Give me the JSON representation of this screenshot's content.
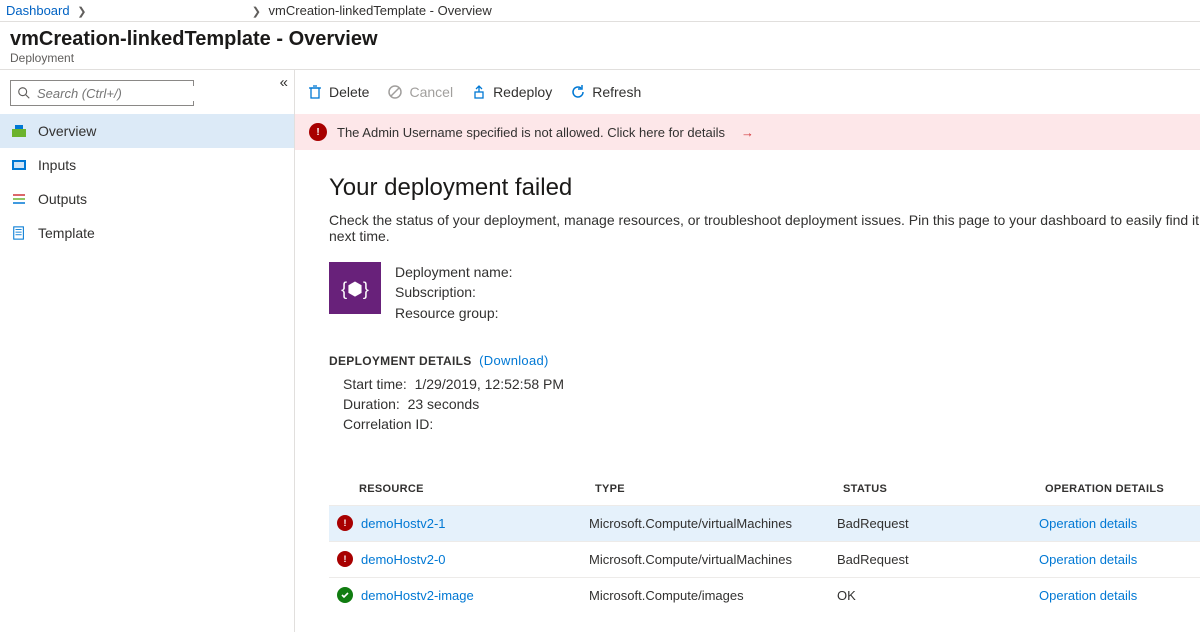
{
  "breadcrumb": {
    "root": "Dashboard",
    "current": "vmCreation-linkedTemplate - Overview"
  },
  "page_title": "vmCreation-linkedTemplate - Overview",
  "page_subtitle": "Deployment",
  "search": {
    "placeholder": "Search (Ctrl+/)"
  },
  "sidebar": {
    "items": [
      {
        "label": "Overview"
      },
      {
        "label": "Inputs"
      },
      {
        "label": "Outputs"
      },
      {
        "label": "Template"
      }
    ]
  },
  "toolbar": {
    "delete": "Delete",
    "cancel": "Cancel",
    "redeploy": "Redeploy",
    "refresh": "Refresh"
  },
  "alert": {
    "message": "The Admin Username specified is not allowed. Click here for details"
  },
  "heading": "Your deployment failed",
  "subtext": "Check the status of your deployment, manage resources, or troubleshoot deployment issues. Pin this page to your dashboard to easily find it next time.",
  "deployment": {
    "name_label": "Deployment name:",
    "subscription_label": "Subscription:",
    "resource_group_label": "Resource group:"
  },
  "details": {
    "header": "DEPLOYMENT DETAILS",
    "download": "(Download)",
    "start_time_label": "Start time:",
    "start_time_value": "1/29/2019, 12:52:58 PM",
    "duration_label": "Duration:",
    "duration_value": "23 seconds",
    "correlation_label": "Correlation ID:"
  },
  "table": {
    "headers": {
      "resource": "RESOURCE",
      "type": "TYPE",
      "status": "STATUS",
      "operation": "OPERATION DETAILS"
    },
    "rows": [
      {
        "status_kind": "error",
        "resource": "demoHostv2-1",
        "type": "Microsoft.Compute/virtualMachines",
        "status": "BadRequest",
        "op": "Operation details"
      },
      {
        "status_kind": "error",
        "resource": "demoHostv2-0",
        "type": "Microsoft.Compute/virtualMachines",
        "status": "BadRequest",
        "op": "Operation details"
      },
      {
        "status_kind": "ok",
        "resource": "demoHostv2-image",
        "type": "Microsoft.Compute/images",
        "status": "OK",
        "op": "Operation details"
      }
    ]
  }
}
